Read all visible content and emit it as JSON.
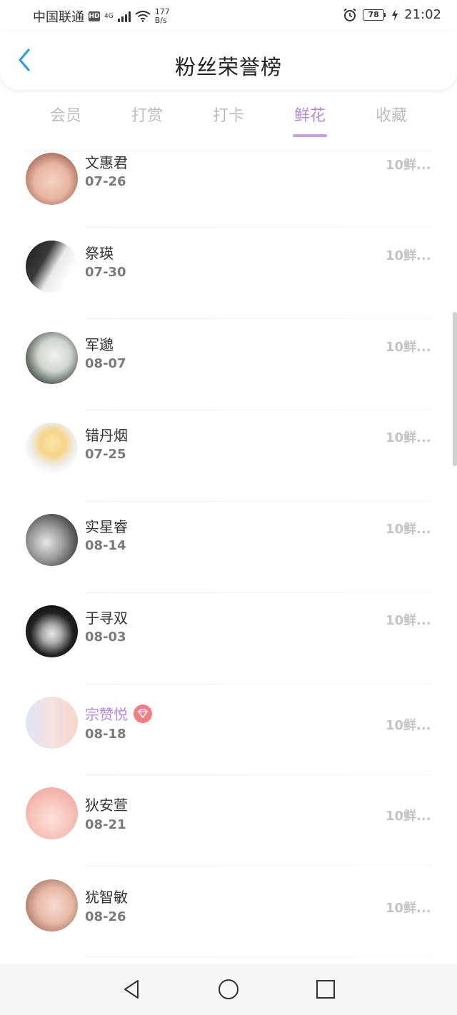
{
  "status_bar": {
    "carrier": "中国联通",
    "hd": "HD",
    "network": "4G",
    "speed_value": "177",
    "speed_unit": "B/s",
    "battery": "78",
    "time": "21:02"
  },
  "header": {
    "title": "粉丝荣誉榜"
  },
  "tabs": [
    {
      "label": "会员",
      "active": false
    },
    {
      "label": "打赏",
      "active": false
    },
    {
      "label": "打卡",
      "active": false
    },
    {
      "label": "鲜花",
      "active": true
    },
    {
      "label": "收藏",
      "active": false
    }
  ],
  "fans": [
    {
      "name": "文惠君",
      "date": "07-26",
      "amount": "10鲜...",
      "vip": false
    },
    {
      "name": "祭瑛",
      "date": "07-30",
      "amount": "10鲜...",
      "vip": false
    },
    {
      "name": "军邈",
      "date": "08-07",
      "amount": "10鲜...",
      "vip": false
    },
    {
      "name": "错丹烟",
      "date": "07-25",
      "amount": "10鲜...",
      "vip": false
    },
    {
      "name": "实星睿",
      "date": "08-14",
      "amount": "10鲜...",
      "vip": false
    },
    {
      "name": "于寻双",
      "date": "08-03",
      "amount": "10鲜...",
      "vip": false
    },
    {
      "name": "宗赞悦",
      "date": "08-18",
      "amount": "10鲜...",
      "vip": true
    },
    {
      "name": "狄安萱",
      "date": "08-21",
      "amount": "10鲜...",
      "vip": false
    },
    {
      "name": "犹智敏",
      "date": "08-26",
      "amount": "10鲜...",
      "vip": false
    }
  ],
  "colors": {
    "accent": "#b48ad9",
    "tab_inactive": "#bdbdbd",
    "vip_badge": "#f57d84",
    "back_icon": "#2c9cf0"
  }
}
